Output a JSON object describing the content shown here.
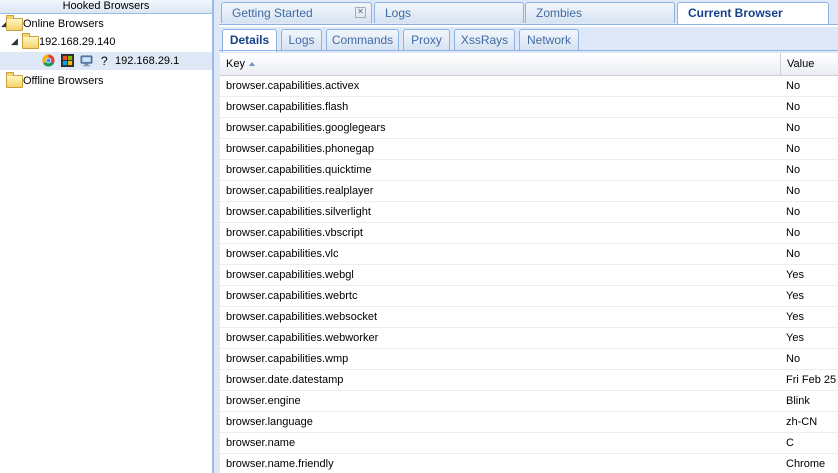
{
  "left_panel": {
    "title": "Hooked Browsers",
    "online_label": "Online Browsers",
    "host_label": "192.168.29.140",
    "browser_label": "192.168.29.1",
    "offline_label": "Offline Browsers",
    "browser_icons": [
      "chrome-icon",
      "windows-icon",
      "monitor-icon",
      "question-icon"
    ],
    "unknown_glyph": "?"
  },
  "main_tabs": [
    {
      "label": "Getting Started",
      "closable": true
    },
    {
      "label": "Logs"
    },
    {
      "label": "Zombies"
    },
    {
      "label": "Current Browser",
      "active": true
    }
  ],
  "sub_tabs": [
    {
      "label": "Details",
      "active": true
    },
    {
      "label": "Logs"
    },
    {
      "label": "Commands"
    },
    {
      "label": "Proxy"
    },
    {
      "label": "XssRays"
    },
    {
      "label": "Network"
    }
  ],
  "grid": {
    "headers": {
      "key": "Key",
      "value": "Value"
    },
    "sort": "ascending",
    "rows": [
      {
        "key": "browser.capabilities.activex",
        "value": "No"
      },
      {
        "key": "browser.capabilities.flash",
        "value": "No"
      },
      {
        "key": "browser.capabilities.googlegears",
        "value": "No"
      },
      {
        "key": "browser.capabilities.phonegap",
        "value": "No"
      },
      {
        "key": "browser.capabilities.quicktime",
        "value": "No"
      },
      {
        "key": "browser.capabilities.realplayer",
        "value": "No"
      },
      {
        "key": "browser.capabilities.silverlight",
        "value": "No"
      },
      {
        "key": "browser.capabilities.vbscript",
        "value": "No"
      },
      {
        "key": "browser.capabilities.vlc",
        "value": "No"
      },
      {
        "key": "browser.capabilities.webgl",
        "value": "Yes"
      },
      {
        "key": "browser.capabilities.webrtc",
        "value": "Yes"
      },
      {
        "key": "browser.capabilities.websocket",
        "value": "Yes"
      },
      {
        "key": "browser.capabilities.webworker",
        "value": "Yes"
      },
      {
        "key": "browser.capabilities.wmp",
        "value": "No"
      },
      {
        "key": "browser.date.datestamp",
        "value": "Fri Feb 25"
      },
      {
        "key": "browser.engine",
        "value": "Blink"
      },
      {
        "key": "browser.language",
        "value": "zh-CN"
      },
      {
        "key": "browser.name",
        "value": "C"
      },
      {
        "key": "browser.name.friendly",
        "value": "Chrome"
      }
    ]
  },
  "colors": {
    "panel_border": "#99bbe8",
    "tab_text": "#416aa3",
    "active_tab_text": "#15428b",
    "selection": "#dfe8f6"
  }
}
